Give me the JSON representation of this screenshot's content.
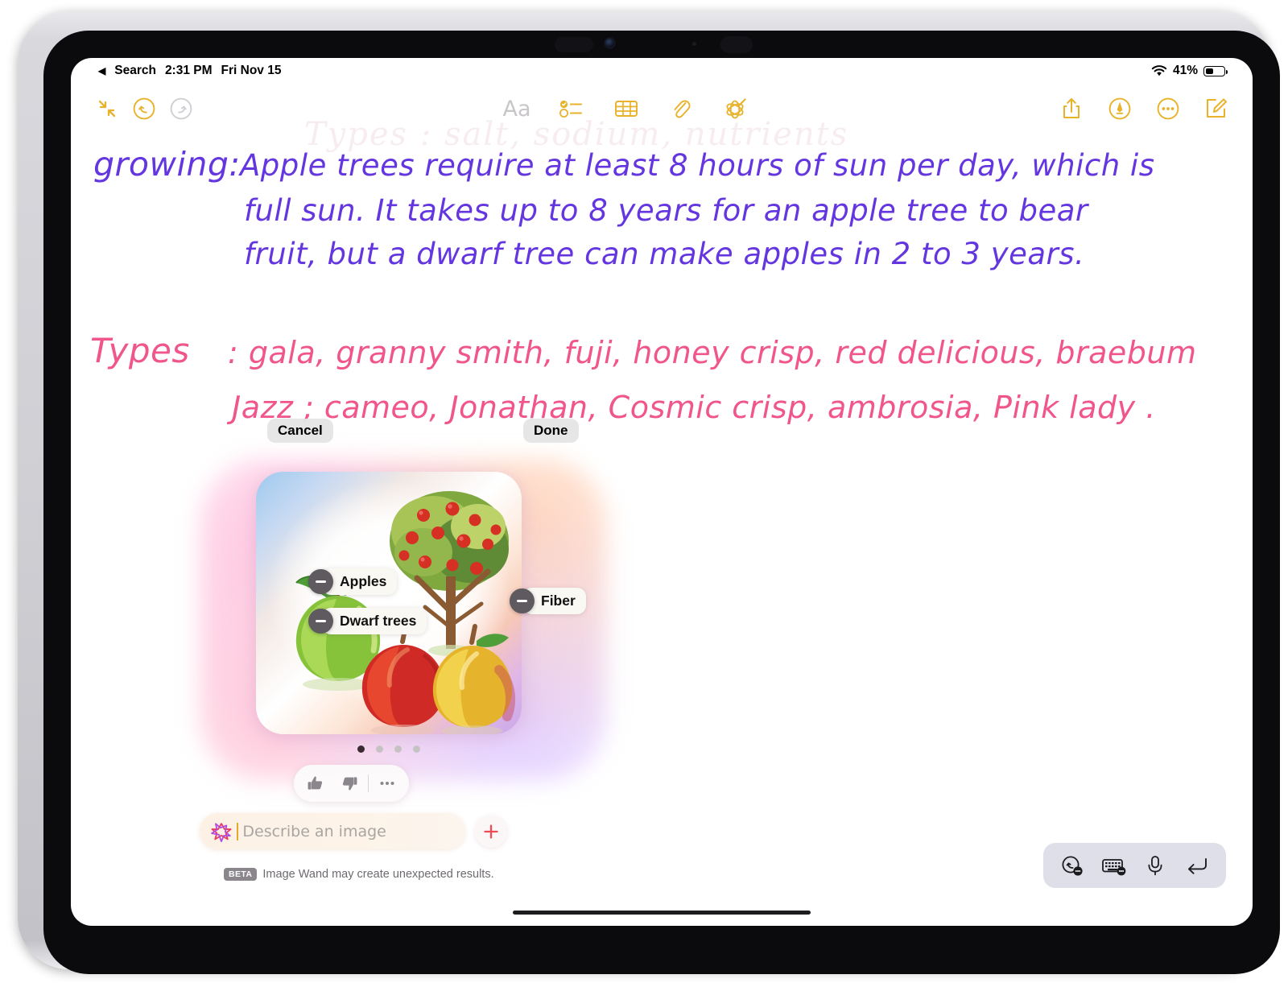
{
  "status_bar": {
    "back_label": "Search",
    "back_caret": "◀",
    "time": "2:31 PM",
    "date": "Fri Nov 15",
    "wifi_icon": "wifi-icon",
    "battery_percent": "41%",
    "battery_icon": "battery-icon"
  },
  "toolbar": {
    "collapse_icon": "collapse-arrows-icon",
    "undo_icon": "undo-icon",
    "redo_icon": "redo-icon",
    "format_label": "Aa",
    "checklist_icon": "checklist-icon",
    "table_icon": "table-icon",
    "attachment_icon": "paperclip-icon",
    "markup_icon": "image-wand-icon",
    "share_icon": "share-icon",
    "pen_icon": "markup-pen-icon",
    "more_icon": "ellipsis-icon",
    "compose_icon": "compose-icon"
  },
  "note": {
    "ghost_line": "Types : salt, sodium, nutrients",
    "paragraphs": [
      {
        "color": "#6436e0",
        "heading": "growing:",
        "lines": [
          "Apple trees require at least 8 hours of sun per day, which  is",
          "full  sun.  It  takes  up to  8  years  for  an  apple  tree  to  bear",
          "fruit, but a dwarf  tree  can  make  apples  in  2 to  3  years."
        ]
      },
      {
        "color": "#f0558c",
        "heading": "Types",
        "lines": [
          ": gala, granny smith,  fuji, honey crisp,  red  delicious,  braebum",
          "Jazz ; cameo, Jonathan,  Cosmic  crisp,  ambrosia,  Pink  lady  ."
        ]
      }
    ]
  },
  "wand": {
    "cancel_label": "Cancel",
    "done_label": "Done",
    "tags": [
      {
        "label": "Apples",
        "remove_icon": "minus-circle-icon"
      },
      {
        "label": "Dwarf trees",
        "remove_icon": "minus-circle-icon"
      },
      {
        "label": "Fiber",
        "remove_icon": "minus-circle-icon"
      }
    ],
    "page_dots": {
      "count": 4,
      "active_index": 0
    },
    "feedback": {
      "thumbs_up_icon": "thumbs-up-icon",
      "thumbs_down_icon": "thumbs-down-icon",
      "more_icon": "ellipsis-icon"
    },
    "prompt": {
      "sparkle_icon": "image-wand-sparkle-icon",
      "placeholder": "Describe an image",
      "value": "",
      "add_icon": "plus-icon"
    },
    "disclaimer": {
      "badge": "BETA",
      "text": "Image Wand may create unexpected results."
    },
    "image_alt": "apples-and-apple-tree-illustration"
  },
  "bottom_bar": {
    "buttons": [
      {
        "icon": "handwriting-undo-icon"
      },
      {
        "icon": "keyboard-icon"
      },
      {
        "icon": "microphone-icon"
      },
      {
        "icon": "dismiss-return-icon"
      }
    ]
  },
  "colors": {
    "accent": "#e8b32a",
    "ink_purple": "#6436e0",
    "ink_pink": "#f0558c"
  }
}
